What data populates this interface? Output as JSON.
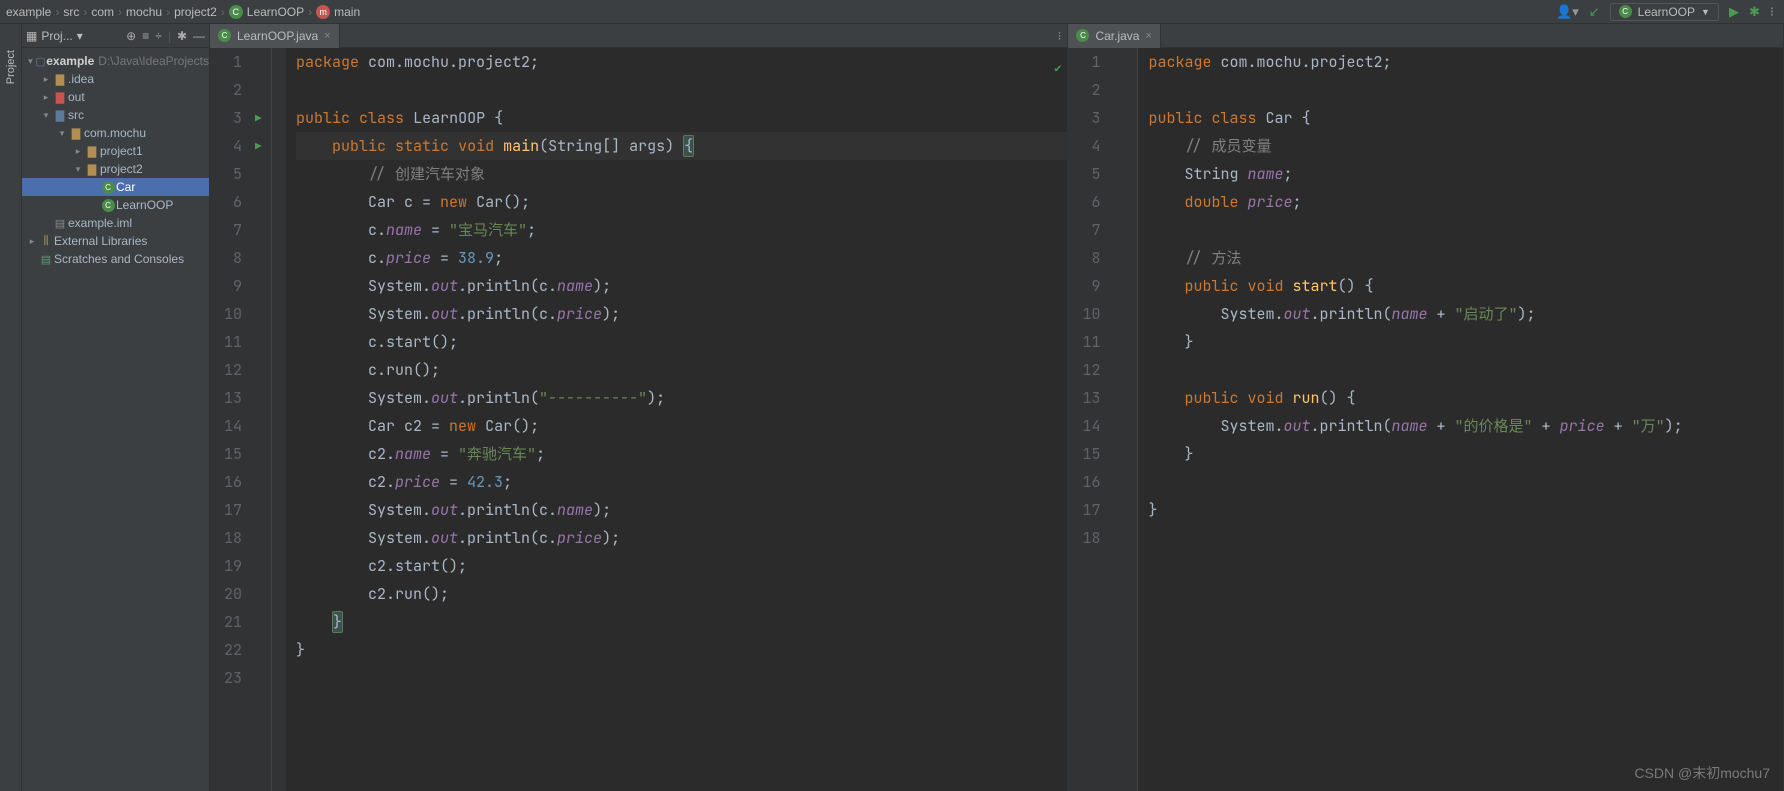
{
  "breadcrumb": [
    "example",
    "src",
    "com",
    "mochu",
    "project2"
  ],
  "breadcrumb_class": "LearnOOP",
  "breadcrumb_method": "main",
  "run_config": "LearnOOP",
  "side_tab": "Project",
  "tool_window_title": "Proj...",
  "tree": {
    "root": "example",
    "root_path": "D:\\Java\\IdeaProjects",
    "idea": ".idea",
    "out": "out",
    "src": "src",
    "pkg": "com.mochu",
    "p1": "project1",
    "p2": "project2",
    "car": "Car",
    "learn": "LearnOOP",
    "iml": "example.iml",
    "ext": "External Libraries",
    "scratch": "Scratches and Consoles"
  },
  "tabs": {
    "left": "LearnOOP.java",
    "right": "Car.java"
  },
  "code_left": {
    "lines": [
      1,
      2,
      3,
      4,
      5,
      6,
      7,
      8,
      9,
      10,
      11,
      12,
      13,
      14,
      15,
      16,
      17,
      18,
      19,
      20,
      21,
      22,
      23
    ],
    "pkg": "package",
    "pkg_name": "com.mochu.project2",
    "public": "public",
    "class": "class",
    "static": "static",
    "void": "void",
    "new": "new",
    "classname": "LearnOOP",
    "main": "main",
    "args": "String[] args",
    "comment1": "// 创建汽车对象",
    "car_type": "Car",
    "c1": "c",
    "c2": "c2",
    "name_f": "name",
    "price_f": "price",
    "s1": "\"宝马汽车\"",
    "n1": "38.9",
    "sys": "System",
    "out": "out",
    "println": "println",
    "dash": "\"----------\"",
    "s2": "\"奔驰汽车\"",
    "n2": "42.3",
    "start_m": "start",
    "run_m": "run"
  },
  "code_right": {
    "lines": [
      1,
      2,
      3,
      4,
      5,
      6,
      7,
      8,
      9,
      10,
      11,
      12,
      13,
      14,
      15,
      16,
      17,
      18
    ],
    "classname": "Car",
    "comment1": "// 成员变量",
    "string_t": "String",
    "double_t": "double",
    "comment2": "// 方法",
    "start_m": "start",
    "run_m": "run",
    "s_launch": "\"启动了\"",
    "s_price": "\"的价格是\"",
    "s_wan": "\"万\""
  },
  "watermark": "CSDN @末初mochu7"
}
